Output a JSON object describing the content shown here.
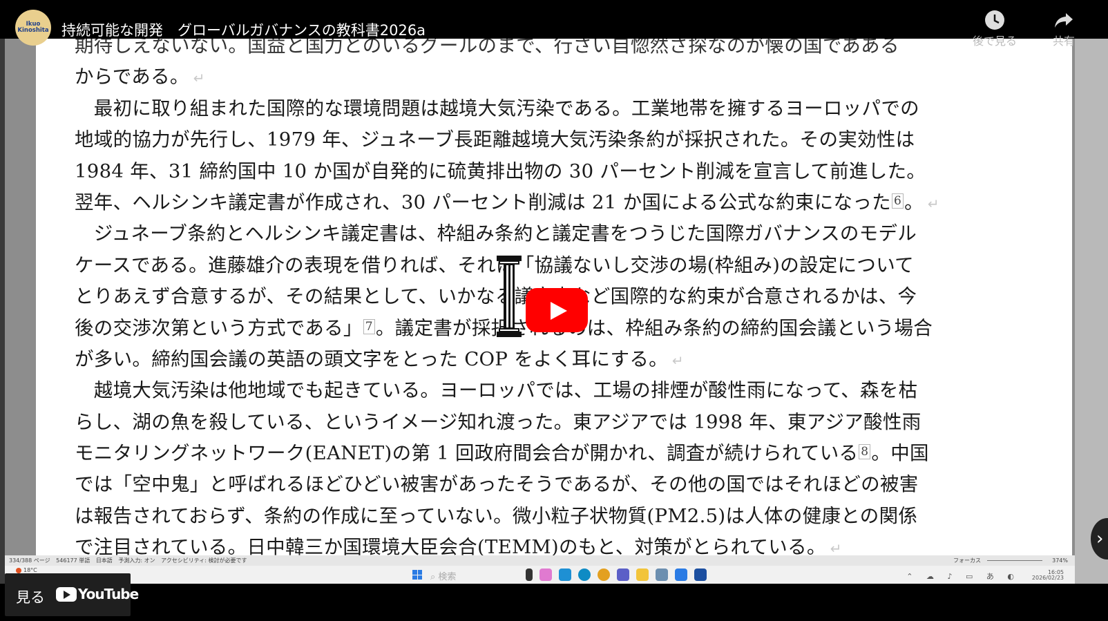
{
  "channel": {
    "logo_line1": "Ikuo",
    "logo_line2": "Kinoshita"
  },
  "video": {
    "title": "持続可能な開発　グローバルガバナンスの教科書2026a"
  },
  "controls": {
    "watch_later_label": "後で見る",
    "share_label": "共有"
  },
  "document": {
    "cut_line": "期待しえないない。国益と国力とのいるグールのまで、行さい自惚然さ探なのが懐の国であある",
    "lines": [
      "からである。",
      "　最初に取り組まれた国際的な環境問題は越境大気汚染である。工業地帯を擁するヨーロッパでの",
      "地域的協力が先行し、1979 年、ジュネーブ長距離越境大気汚染条約が採択された。その実効性は",
      "1984 年、31 締約国中 10 か国が自発的に硫黄排出物の 30 パーセント削減を宣言して前進した。",
      "翌年、ヘルシンキ議定書が作成され、30 パーセント削減は 21 か国による公式な約束になった",
      "　ジュネーブ条約とヘルシンキ議定書は、枠組み条約と議定書をつうじた国際ガバナンスのモデル",
      "ケースである。進藤雄介の表現を借りれば、それは「協議ないし交渉の場(枠組み)の設定について",
      "とりあえず合意するが、その結果として、いかなる議定書など国際的な約束が合意されるかは、今",
      "後の交渉次第という方式である」",
      "が多い。締約国会議の英語の頭文字をとった COP をよく耳にする。",
      "　越境大気汚染は他地域でも起きている。ヨーロッパでは、工場の排煙が酸性雨になって、森を枯",
      "らし、湖の魚を殺している、というイメージ知れ渡った。東アジアでは 1998 年、東アジア酸性雨",
      "モニタリングネットワーク(EANET)の第 1 回政府間会合が開かれ、調査が続けられている",
      "では「空中鬼」と呼ばれるほどひどい被害があったそうであるが、その他の国ではそれほどの被害",
      "は報告されておらず、条約の作成に至っていない。微小粒子状物質(PM2.5)は人体の健康との関係",
      "で注目されている。日中韓三か国環境大臣会合(TEMM)のもと、対策がとられている。"
    ],
    "line4_end": "。",
    "line8_tail": "。議定書が採択されるのは、枠組み条約の締約国会議という場合",
    "line12_tail": "。中国",
    "footnotes": {
      "fn6": "6",
      "fn7": "7",
      "fn8": "8"
    },
    "para_mark": "↵"
  },
  "word_status": {
    "page": "334/388 ページ",
    "words": "546177 単語",
    "lang": "日本語",
    "ime": "予測入力: オン",
    "access": "アクセシビリティ: 検討が必要です",
    "focus": "フォーカス",
    "zoom": "374%"
  },
  "taskbar": {
    "weather": "18°C",
    "search_placeholder": "検索",
    "time": "16:05",
    "date": "2026/02/23"
  },
  "youtube": {
    "watch_label": "見る",
    "logo_text": "YouTube"
  },
  "colors": {
    "play_red": "#ff0000",
    "logo_bg": "#e9cf8e",
    "logo_text": "#1f3f8a"
  }
}
